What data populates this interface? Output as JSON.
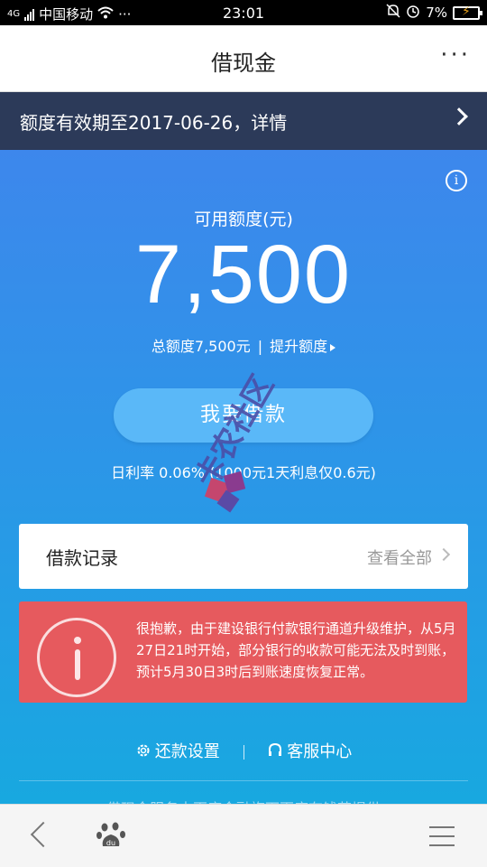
{
  "status": {
    "network": "4G",
    "carrier": "中国移动",
    "extras": "···",
    "time": "23:01",
    "battery": "7%"
  },
  "header": {
    "title": "借现金",
    "more": "···"
  },
  "notice": {
    "text": "额度有效期至2017-06-26，详情"
  },
  "main": {
    "available_label": "可用额度(元)",
    "available_amount": "7,500",
    "total_limit": "总额度7,500元",
    "raise_limit": "提升额度",
    "borrow_button": "我要借款",
    "rate_text": "日利率 0.06% (1000元1天利息仅0.6元)"
  },
  "records": {
    "label": "借款记录",
    "view_all": "查看全部"
  },
  "alert": {
    "text": "很抱歉，由于建设银行付款银行通道升级维护，从5月27日21时开始，部分银行的收款可能无法及时到账，预计5月30日3时后到账速度恢复正常。"
  },
  "footer": {
    "repay_settings": "还款设置",
    "customer_service": "客服中心",
    "note": "借现金服务由百度金融旗下百度有钱花提供"
  },
  "watermark": {
    "text": "卡农社区"
  },
  "colors": {
    "accent": "#3d87ec",
    "notice_bg": "#2c3a59",
    "alert_bg": "#e65a5e",
    "button_bg": "#5ab8f8"
  },
  "icons": [
    "signal-icon",
    "wifi-icon",
    "bell-mute-icon",
    "alarm-icon",
    "battery-icon",
    "info-icon",
    "gear-icon",
    "headset-icon",
    "back-icon",
    "baidu-paw-icon",
    "menu-icon"
  ]
}
